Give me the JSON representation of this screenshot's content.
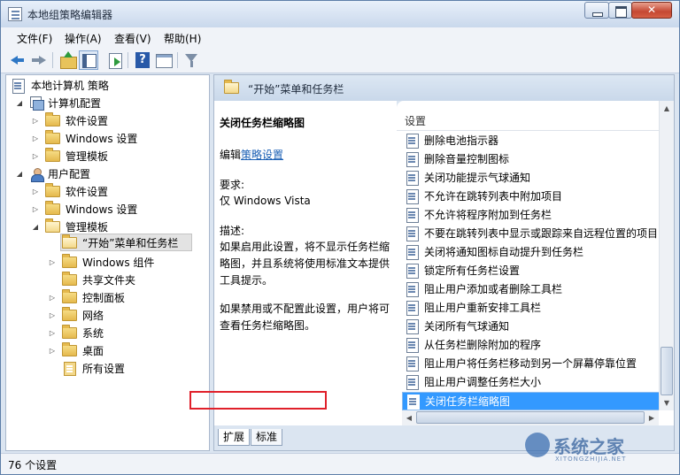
{
  "window": {
    "title": "本地组策略编辑器"
  },
  "menubar": {
    "items": [
      "文件(F)",
      "操作(A)",
      "查看(V)",
      "帮助(H)"
    ]
  },
  "tree": {
    "root": "本地计算机 策略",
    "computer_config": "计算机配置",
    "cc_children": [
      "软件设置",
      "Windows 设置",
      "管理模板"
    ],
    "user_config": "用户配置",
    "uc_children": [
      "软件设置",
      "Windows 设置",
      "管理模板"
    ],
    "admin_children": [
      "“开始”菜单和任务栏",
      "Windows 组件",
      "共享文件夹",
      "控制面板",
      "网络",
      "系统",
      "桌面",
      "所有设置"
    ]
  },
  "right": {
    "header": "“开始”菜单和任务栏",
    "desc": {
      "title": "关闭任务栏缩略图",
      "edit_prefix": "编辑",
      "edit_link": "策略设置",
      "req_label": "要求:",
      "req_value": "仅 Windows Vista",
      "desc_label": "描述:",
      "desc_lines": [
        "如果启用此设置，将不显示任务栏缩",
        "略图，并且系统将使用标准文本提供",
        "工具提示。"
      ],
      "desc2_lines": [
        "如果禁用或不配置此设置，用户将可",
        "查看任务栏缩略图。"
      ]
    },
    "list_header": "设置",
    "items": [
      "删除电池指示器",
      "删除音量控制图标",
      "关闭功能提示气球通知",
      "不允许在跳转列表中附加项目",
      "不允许将程序附加到任务栏",
      "不要在跳转列表中显示或跟踪来自远程位置的项目",
      "关闭将通知图标自动提升到任务栏",
      "锁定所有任务栏设置",
      "阻止用户添加或者删除工具栏",
      "阻止用户重新安排工具栏",
      "关闭所有气球通知",
      "从任务栏删除附加的程序",
      "阻止用户将任务栏移动到另一个屏幕停靠位置",
      "阻止用户调整任务栏大小",
      "关闭任务栏缩略图"
    ],
    "tabs": [
      "扩展",
      "标准"
    ]
  },
  "status": {
    "text": "76 个设置"
  },
  "watermark": {
    "text": "系统之家",
    "sub": "XITONGZHIJIA.NET"
  }
}
